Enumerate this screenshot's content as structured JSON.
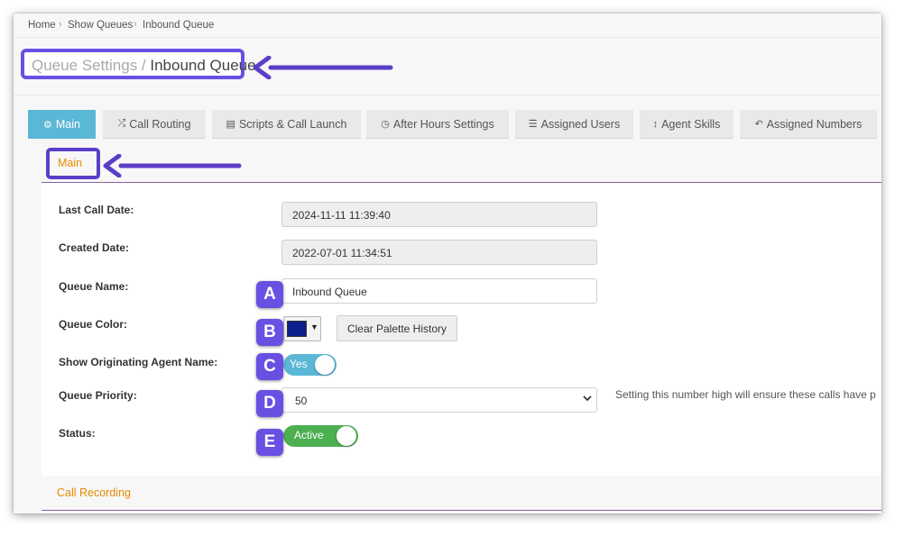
{
  "breadcrumb": {
    "items": [
      "Home",
      "Show Queues",
      "Inbound Queue"
    ],
    "separator": "›"
  },
  "page_title": {
    "section": "Queue Settings /",
    "name": "Inbound Queue"
  },
  "tabs": [
    {
      "icon": "⚙",
      "icon_name": "gear-icon",
      "label": "Main",
      "active": true
    },
    {
      "icon": "⤮",
      "icon_name": "shuffle-icon",
      "label": "Call Routing",
      "active": false
    },
    {
      "icon": "▤",
      "icon_name": "script-icon",
      "label": "Scripts & Call Launch",
      "active": false
    },
    {
      "icon": "◷",
      "icon_name": "clock-icon",
      "label": "After Hours Settings",
      "active": false
    },
    {
      "icon": "☰",
      "icon_name": "list-icon",
      "label": "Assigned Users",
      "active": false
    },
    {
      "icon": "↕",
      "icon_name": "arrows-vertical-icon",
      "label": "Agent Skills",
      "active": false
    },
    {
      "icon": "↶",
      "icon_name": "reply-icon",
      "label": "Assigned Numbers",
      "active": false
    }
  ],
  "section": {
    "title": "Main"
  },
  "fields": {
    "last_call_date": {
      "label": "Last Call Date:",
      "value": "2024-11-11 11:39:40"
    },
    "created_date": {
      "label": "Created Date:",
      "value": "2022-07-01 11:34:51"
    },
    "queue_name": {
      "label": "Queue Name:",
      "value": "Inbound Queue"
    },
    "queue_color": {
      "label": "Queue Color:",
      "value": "#0d1f8c",
      "clear_button": "Clear Palette History"
    },
    "show_originating_agent": {
      "label": "Show Originating Agent Name:",
      "value": "Yes",
      "on": true
    },
    "queue_priority": {
      "label": "Queue Priority:",
      "value": "50",
      "help": "Setting this number high will ensure these calls have p"
    },
    "status": {
      "label": "Status:",
      "value": "Active",
      "on": true
    }
  },
  "badges": [
    "A",
    "B",
    "C",
    "D",
    "E"
  ],
  "call_recording": {
    "title": "Call Recording"
  },
  "colors": {
    "annotation": "#6a4fe3",
    "active_tab": "#5bb7d6",
    "section_title": "#e88a00",
    "toggle_blue": "#5bb7d6",
    "toggle_green": "#4caf50"
  }
}
